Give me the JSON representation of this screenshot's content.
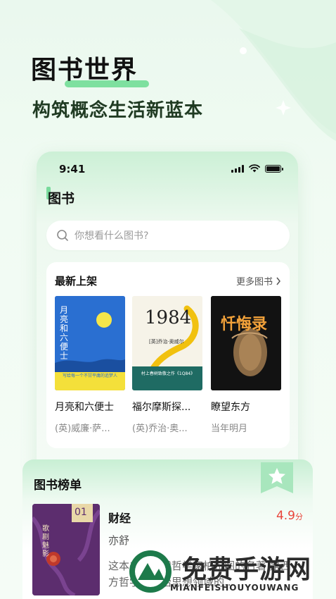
{
  "hero": {
    "title": "图书世界",
    "subtitle": "构筑概念生活新蓝本"
  },
  "status_bar": {
    "time": "9:41"
  },
  "app": {
    "title": "图书",
    "search_placeholder": "你想看什么图书?"
  },
  "new_arrivals": {
    "heading": "最新上架",
    "more_label": "更多图书",
    "books": [
      {
        "title": "月亮和六便士",
        "author": "(英)威廉·萨...",
        "cover_text": "月亮和六便士",
        "cover_note": "写给每一个不甘平庸的追梦人",
        "cover_color": "#2a6fd1"
      },
      {
        "title": "福尔摩斯探...",
        "author": "(英)乔治·奥...",
        "cover_text": "1984",
        "cover_note": "[英]乔治·奥威尔",
        "cover_note2": "村上春树致敬之作《1Q84》",
        "cover_color": "#f1c10f"
      },
      {
        "title": "瞭望东方",
        "author": "当年明月",
        "cover_text": "忏悔录",
        "cover_color": "#121212"
      }
    ]
  },
  "ranking": {
    "heading": "图书榜单",
    "item": {
      "rank": "01",
      "name": "财经",
      "author": "亦舒",
      "score": "4.9",
      "score_unit": "分",
      "description": "这本书是古代哲学家柏拉图的名著,是西方哲学与政治思想领域的...",
      "cover_text": "歌剧魅影",
      "cover_color": "#5c2d6e"
    }
  },
  "watermark": {
    "text": "免费手游网",
    "sub": "MIANFEISHOUYOUWANG"
  },
  "colors": {
    "accent": "#4fcf7e",
    "score": "#e8443a"
  }
}
